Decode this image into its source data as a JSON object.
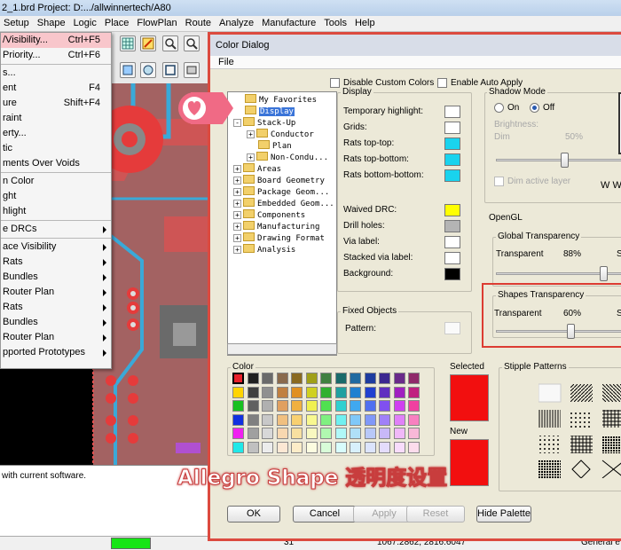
{
  "app": {
    "title": "2_1.brd  Project: D:.../allwinnertech/A80"
  },
  "menubar": [
    "Setup",
    "Shape",
    "Logic",
    "Place",
    "FlowPlan",
    "Route",
    "Analyze",
    "Manufacture",
    "Tools",
    "Help"
  ],
  "dropdown": {
    "items": [
      {
        "label": "/Visibility...",
        "shortcut": "Ctrl+F5",
        "highlight": true
      },
      {
        "label": "Priority...",
        "shortcut": "Ctrl+F6"
      },
      {
        "sep": true
      },
      {
        "label": "s..."
      },
      {
        "label": "ent",
        "shortcut": "F4"
      },
      {
        "label": "ure",
        "shortcut": "Shift+F4"
      },
      {
        "label": "raint"
      },
      {
        "label": "erty..."
      },
      {
        "label": "tic"
      },
      {
        "label": "ments Over Voids"
      },
      {
        "sep": true
      },
      {
        "label": "n Color"
      },
      {
        "label": "ght"
      },
      {
        "label": "hlight"
      },
      {
        "sep": true
      },
      {
        "label": "e DRCs",
        "submenu": true
      },
      {
        "sep": true
      },
      {
        "label": "ace Visibility",
        "submenu": true
      },
      {
        "label": "Rats",
        "submenu": true
      },
      {
        "label": "Bundles",
        "submenu": true
      },
      {
        "label": "Router Plan",
        "submenu": true
      },
      {
        "label": "Rats",
        "submenu": true
      },
      {
        "label": "Bundles",
        "submenu": true
      },
      {
        "label": "Router Plan",
        "submenu": true
      },
      {
        "label": "pported Prototypes",
        "submenu": true
      }
    ]
  },
  "command_pane": {
    "text": "with current software."
  },
  "statusbar": {
    "pick": "31",
    "coords": "1067.2862, 2816.6047",
    "mode": "General e"
  },
  "dialog": {
    "title": "Color Dialog",
    "file_menu": "File",
    "disable_custom_colors": "Disable Custom Colors",
    "enable_auto_apply": "Enable Auto Apply",
    "tree": [
      {
        "label": "My Favorites",
        "depth": 0,
        "expander": ""
      },
      {
        "label": "Display",
        "depth": 0,
        "expander": "",
        "selected": true
      },
      {
        "label": "Stack-Up",
        "depth": 0,
        "expander": "-"
      },
      {
        "label": "Conductor",
        "depth": 1,
        "expander": "+"
      },
      {
        "label": "Plan",
        "depth": 1,
        "expander": ""
      },
      {
        "label": "Non-Condu...",
        "depth": 1,
        "expander": "+"
      },
      {
        "label": "Areas",
        "depth": 0,
        "expander": "+"
      },
      {
        "label": "Board Geometry",
        "depth": 0,
        "expander": "+"
      },
      {
        "label": "Package Geom...",
        "depth": 0,
        "expander": "+"
      },
      {
        "label": "Embedded Geom...",
        "depth": 0,
        "expander": "+"
      },
      {
        "label": "Components",
        "depth": 0,
        "expander": "+"
      },
      {
        "label": "Manufacturing",
        "depth": 0,
        "expander": "+"
      },
      {
        "label": "Drawing Format",
        "depth": 0,
        "expander": "+"
      },
      {
        "label": "Analysis",
        "depth": 0,
        "expander": "+"
      }
    ],
    "display": {
      "heading": "Display",
      "rows": [
        {
          "label": "Temporary highlight:",
          "color": "#ffffff"
        },
        {
          "label": "Grids:",
          "color": "#ffffff"
        },
        {
          "label": "Rats top-top:",
          "color": "#19d3ee"
        },
        {
          "label": "Rats top-bottom:",
          "color": "#19d3ee"
        },
        {
          "label": "Rats bottom-bottom:",
          "color": "#19d3ee"
        },
        {
          "label": "Waived DRC:",
          "color": "#ffff00"
        },
        {
          "label": "Drill holes:",
          "color": "#b4b4b4"
        },
        {
          "label": "Via label:",
          "color": "#ffffff"
        },
        {
          "label": "Stacked via label:",
          "color": "#ffffff"
        },
        {
          "label": "Background:",
          "color": "#000000"
        }
      ]
    },
    "fixed_objects": {
      "heading": "Fixed Objects",
      "pattern_label": "Pattern:"
    },
    "shadow_mode": {
      "heading": "Shadow Mode",
      "on_label": "On",
      "off_label": "Off",
      "selected": "Off",
      "brightness_label": "Brightness:",
      "dim_label": "Dim",
      "dim_value": "50%",
      "dim_active_layer": "Dim active layer",
      "ww_text": "W W"
    },
    "opengl": {
      "heading": "OpenGL",
      "global_heading": "Global Transparency",
      "global_label": "Transparent",
      "global_value": "88%",
      "global_level": 0.88,
      "shapes_heading": "Shapes Transparency",
      "shapes_label": "Transparent",
      "shapes_value": "60%",
      "shapes_level": 0.6,
      "trail_letter": "S"
    },
    "color_section": {
      "heading": "Color",
      "selected_heading": "Selected",
      "new_heading": "New",
      "selected_color": "#f20f0f",
      "new_color": "#f20f0f",
      "palette": [
        [
          "#e8212a",
          "#202020",
          "#6a6a6a",
          "#8a6a4c",
          "#8a6a20",
          "#a0a018",
          "#408040",
          "#1a6a6a",
          "#206aa0",
          "#1e3ca0",
          "#3c2890",
          "#6a2a8a",
          "#902a6a"
        ],
        [
          "#ffd400",
          "#404040",
          "#909090",
          "#c08040",
          "#e09020",
          "#d0d020",
          "#30b030",
          "#20a0a0",
          "#2080d0",
          "#2040d0",
          "#6030c0",
          "#a020c0",
          "#c02080"
        ],
        [
          "#18c020",
          "#606060",
          "#b0b0b0",
          "#e0a060",
          "#f0b040",
          "#f0f050",
          "#50e050",
          "#30d0d0",
          "#40a8f0",
          "#5070f0",
          "#8050f0",
          "#d040f0",
          "#f040a0"
        ],
        [
          "#1030e0",
          "#808080",
          "#c8c8c8",
          "#f0c080",
          "#f8d070",
          "#f8f890",
          "#80f080",
          "#70f0f0",
          "#80c8f8",
          "#8098f8",
          "#a080f8",
          "#e080f8",
          "#f880c0"
        ],
        [
          "#f020f0",
          "#a0a0a0",
          "#d8d8d8",
          "#f8d8b0",
          "#f8e0a0",
          "#f8f8c0",
          "#b0f8b0",
          "#b0f8f8",
          "#b0e0f8",
          "#b8c8f8",
          "#c8b8f8",
          "#f0b8f8",
          "#f8b8d8"
        ],
        [
          "#20e8e8",
          "#c0c0c0",
          "#ececec",
          "#fce8d4",
          "#fcecc8",
          "#fcfce0",
          "#d8fcd8",
          "#d8fcfc",
          "#d8f0fc",
          "#dce4fc",
          "#e4dcfc",
          "#f8dcfc",
          "#fcdcec"
        ]
      ]
    },
    "stipple": {
      "heading": "Stipple Patterns"
    },
    "buttons": {
      "ok": "OK",
      "cancel": "Cancel",
      "apply": "Apply",
      "reset": "Reset",
      "hide_palette": "Hide Palette"
    }
  },
  "overlay": {
    "caption": "Allegro Shape 透明度设置",
    "heart_icon": "heart-icon"
  }
}
